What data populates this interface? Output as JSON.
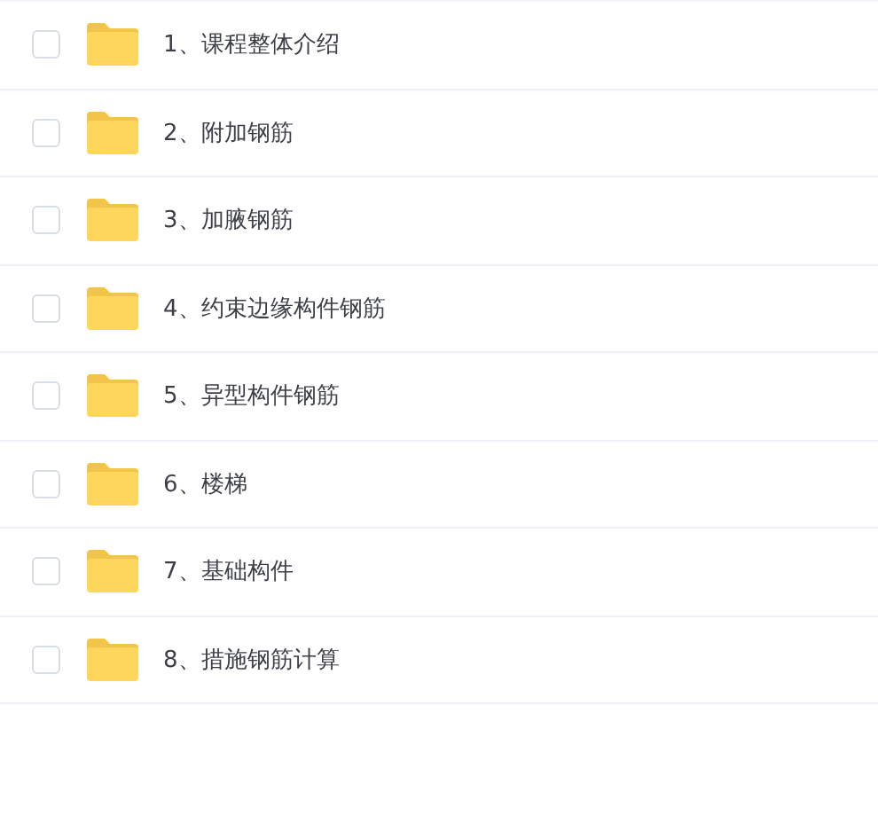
{
  "folders": [
    {
      "name": "1、课程整体介绍",
      "checked": false
    },
    {
      "name": "2、附加钢筋",
      "checked": false
    },
    {
      "name": "3、加腋钢筋",
      "checked": false
    },
    {
      "name": "4、约束边缘构件钢筋",
      "checked": false
    },
    {
      "name": "5、异型构件钢筋",
      "checked": false
    },
    {
      "name": "6、楼梯",
      "checked": false
    },
    {
      "name": "7、基础构件",
      "checked": false
    },
    {
      "name": "8、措施钢筋计算",
      "checked": false
    }
  ]
}
